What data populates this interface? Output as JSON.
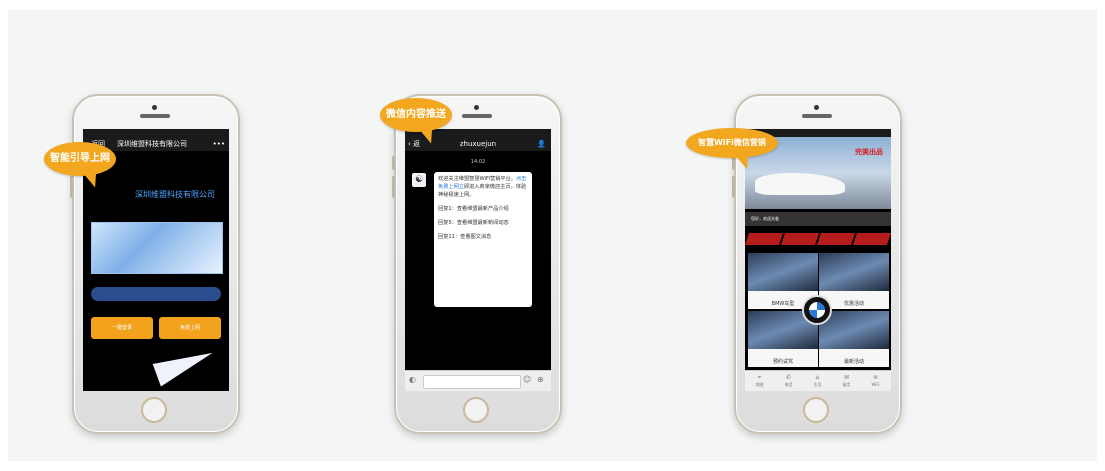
{
  "phones": [
    {
      "bubble": "智能引导上网",
      "nav_back": "返回",
      "nav_title": "深圳维盟科技有限公司",
      "nav_more": "•••",
      "headline": "深圳维盟科技有限公司",
      "buttons": [
        "一键登录",
        "免费上网"
      ]
    },
    {
      "bubble": "微信内容推送",
      "nav_back": "返",
      "nav_title": "zhuxuejun",
      "user_icon": "user-icon",
      "time": "14:02",
      "message": {
        "p1_pre": "欢迎关注维盟智慧WiFi营销平台。",
        "p1_link": "点击免费上网立",
        "p1_post": "即进入商家微店主页，体验神秘极速上网。",
        "p2": "回复1：查看维盟最新产品介绍",
        "p3": "回复5：查看维盟最新新闻动态",
        "p4": "回复11：查看图文消息"
      }
    },
    {
      "bubble": "智慧WiFi微信营销",
      "hero_brand": "完美出品",
      "welcome": "您好，欢迎光临",
      "tiles": [
        "BMW车型",
        "优惠活动",
        "预约试驾",
        "最新活动"
      ],
      "tabs": [
        "地图",
        "电话",
        "主页",
        "留言",
        "WiFi"
      ]
    }
  ],
  "colors": {
    "bubble": "#f2a71f",
    "phone_frame": "#c9c2b4"
  }
}
